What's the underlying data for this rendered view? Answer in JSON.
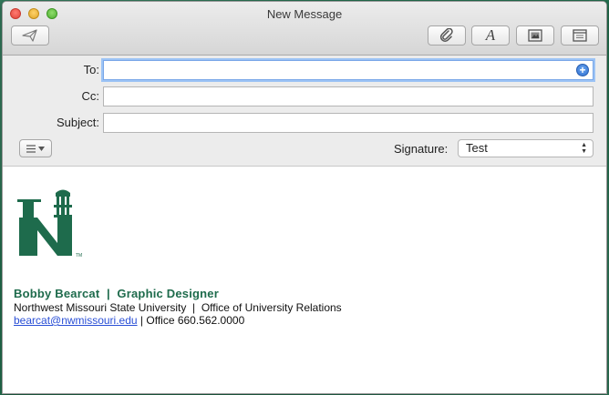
{
  "window": {
    "title": "New Message"
  },
  "toolbar": {
    "send_icon": "paper-plane-icon",
    "attach_icon": "paperclip-icon",
    "font_icon": "font-A-icon",
    "photo_icon": "photo-browser-icon",
    "template_icon": "stationery-icon",
    "font_glyph": "A"
  },
  "fields": {
    "to_label": "To:",
    "to_value": "",
    "cc_label": "Cc:",
    "cc_value": "",
    "subject_label": "Subject:",
    "subject_value": ""
  },
  "format_menu": {
    "icon": "list-icon"
  },
  "signature": {
    "label": "Signature:",
    "selected": "Test"
  },
  "body": {
    "name_title": "Bobby Bearcat  |  Graphic Designer",
    "org_line": "Northwest Missouri State University  |  Office of University Relations",
    "email": "bearcat@nwmissouri.edu",
    "phone_sep": " | ",
    "phone": "Office 660.562.0000"
  },
  "colors": {
    "brand_green": "#1e6b4c",
    "link_blue": "#2a4fd6",
    "focus_blue": "#7aa7e8"
  }
}
